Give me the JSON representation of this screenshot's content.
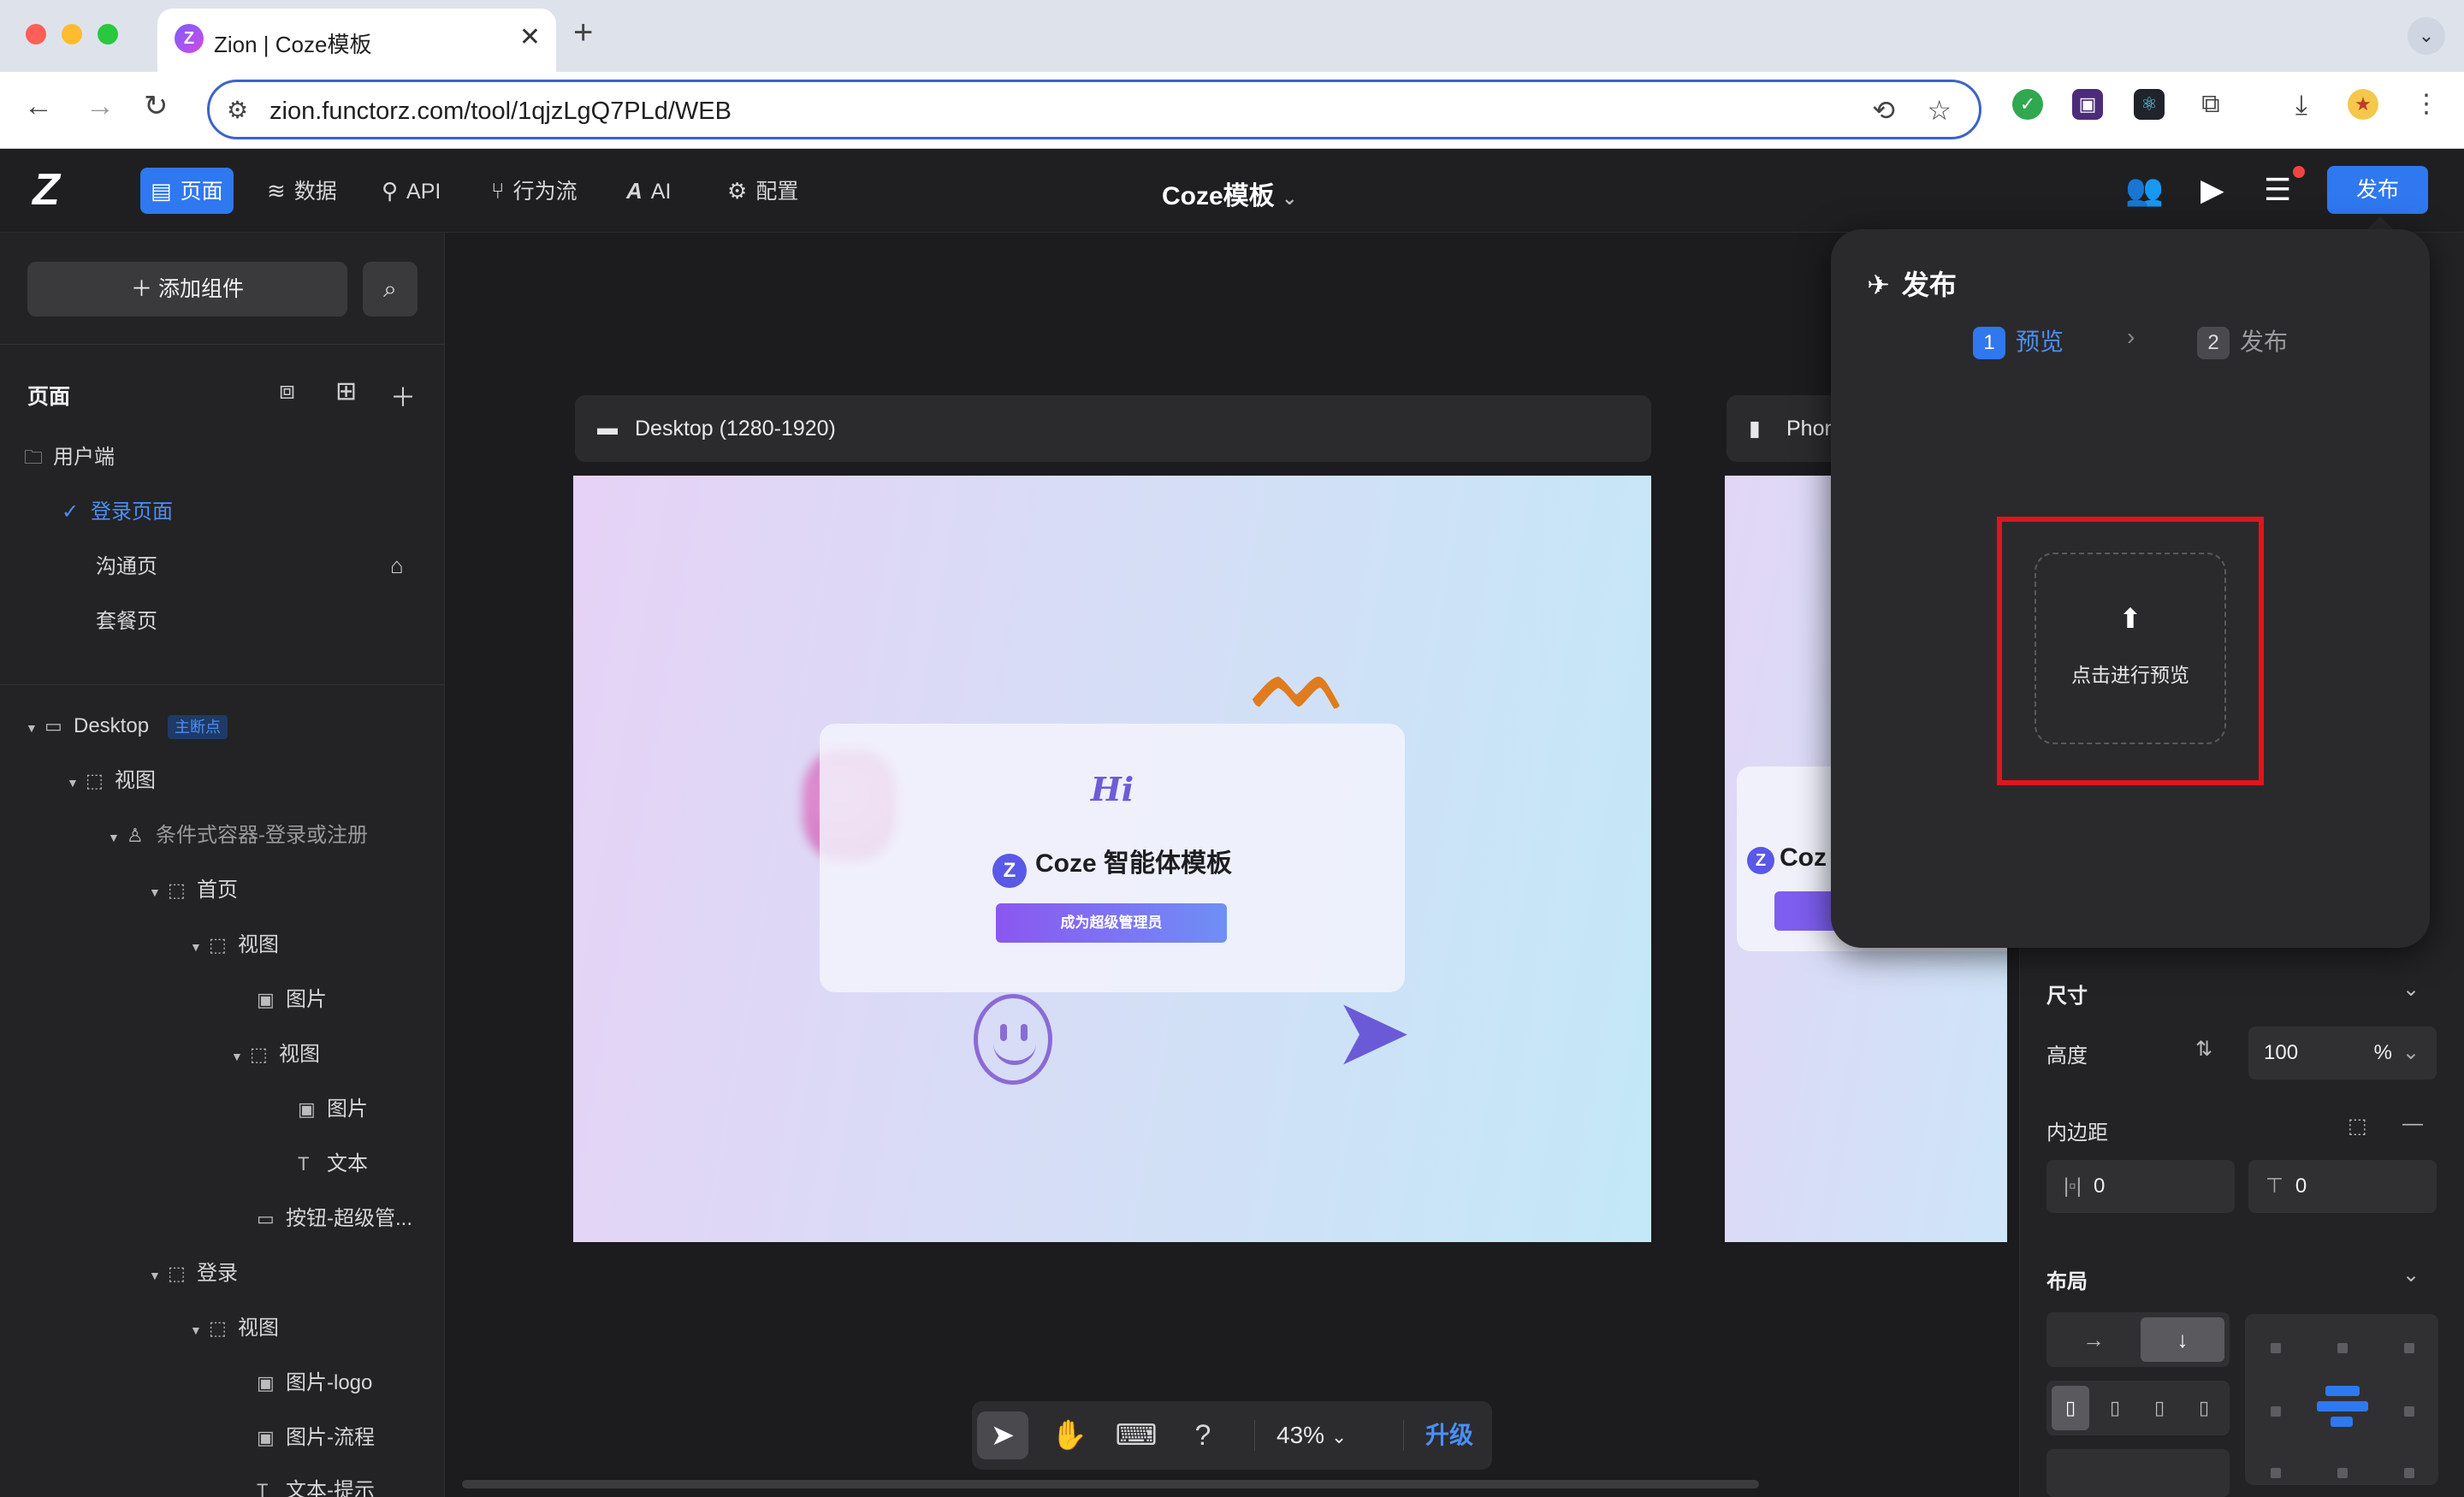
{
  "browser": {
    "tab_title": "Zion | Coze模板",
    "favicon": "Z",
    "close": "✕",
    "new_tab": "+",
    "url": "zion.functorz.com/tool/1qjzLgQ7PLd/WEB"
  },
  "app": {
    "menu": [
      {
        "label": "页面",
        "icon": "page-icon"
      },
      {
        "label": "数据",
        "icon": "database-icon"
      },
      {
        "label": "API",
        "icon": "api-icon"
      },
      {
        "label": "行为流",
        "icon": "flow-icon"
      },
      {
        "label": "AI",
        "icon": "ai-icon"
      },
      {
        "label": "配置",
        "icon": "gear-icon"
      }
    ],
    "title": "Coze模板",
    "publish_button": "发布"
  },
  "sidebar": {
    "add_component": "添加组件",
    "pages_title": "页面",
    "pages": {
      "group": "用户端",
      "items": [
        "登录页面",
        "沟通页",
        "套餐页"
      ]
    },
    "tree": {
      "desktop": "Desktop",
      "desktop_badge": "主断点",
      "nodes": [
        "视图",
        "条件式容器-登录或注册",
        "首页",
        "视图",
        "图片",
        "视图",
        "图片",
        "文本",
        "按钮-超级管...",
        "登录",
        "视图",
        "图片-logo",
        "图片-流程",
        "文本-提示"
      ]
    }
  },
  "canvas": {
    "desktop_label": "Desktop (1280-1920)",
    "phone_label": "Phone",
    "preview": {
      "hi": "Hi",
      "title": "Coze 智能体模板",
      "button": "成为超级管理员"
    },
    "phone_preview_title": "Coz"
  },
  "toolbar": {
    "zoom": "43%",
    "upgrade": "升级"
  },
  "right_panel": {
    "size_title": "尺寸",
    "height_label": "高度",
    "height_value": "100",
    "height_unit": "%",
    "padding_label": "内边距",
    "padding_h": "0",
    "padding_v": "0",
    "layout_title": "布局"
  },
  "popover": {
    "title": "发布",
    "step1_num": "1",
    "step1": "预览",
    "step2_num": "2",
    "step2": "发布",
    "upload_label": "点击进行预览"
  },
  "colors": {
    "accent": "#2f78f0",
    "highlight": "#e0141e"
  }
}
